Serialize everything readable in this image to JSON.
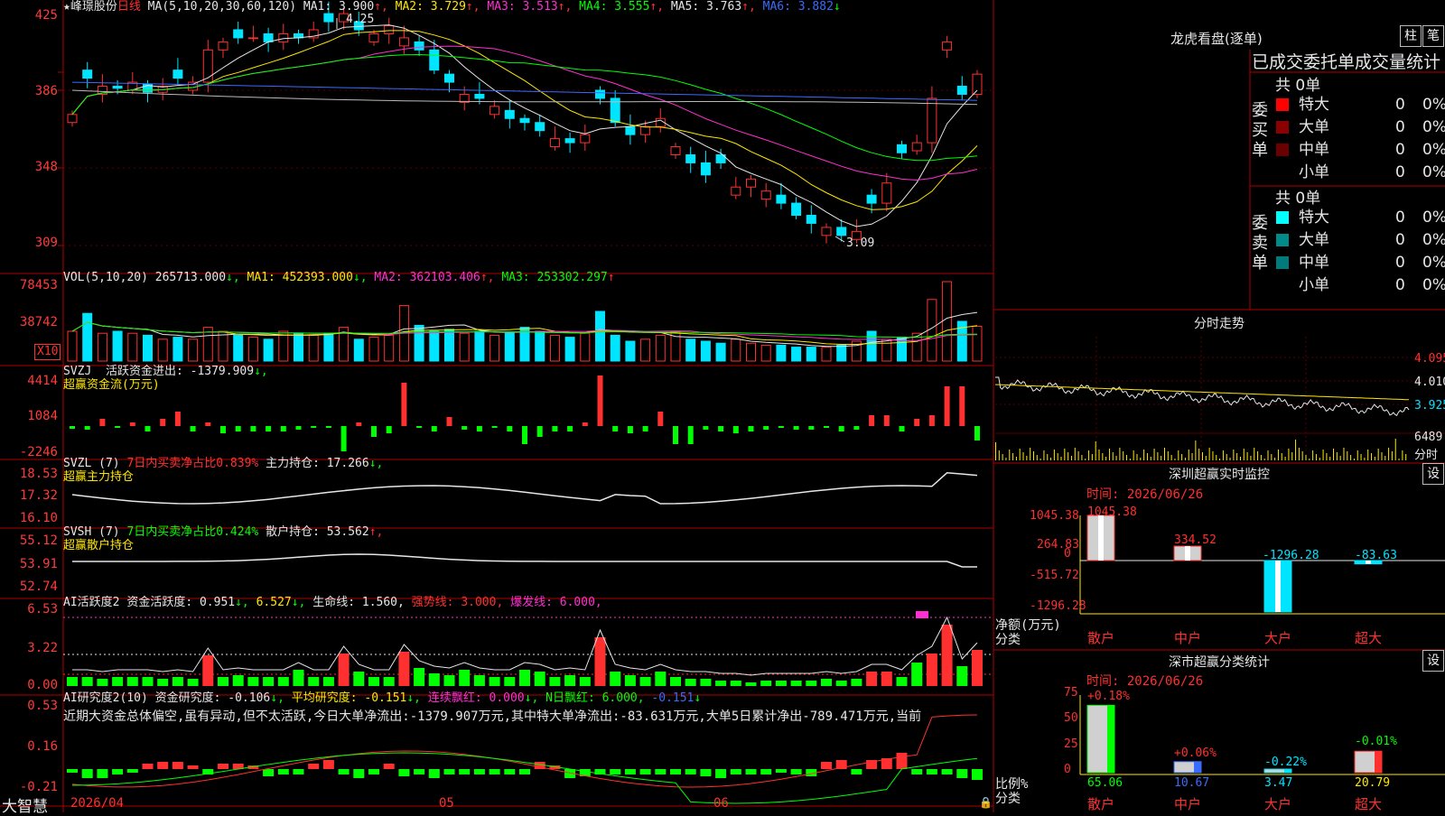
{
  "kline": {
    "stock_name": "★峰璟股份",
    "period": "日线",
    "ma_params": "MA(5,10,20,30,60,120)",
    "indicators": [
      {
        "label": "MA1:",
        "value": "3.900",
        "arrow": "↑",
        "color": "#e6e6e6"
      },
      {
        "label": "MA2:",
        "value": "3.729",
        "arrow": "↑",
        "color": "#ffe600"
      },
      {
        "label": "MA3:",
        "value": "3.513",
        "arrow": "↑",
        "color": "#ff2fd1"
      },
      {
        "label": "MA4:",
        "value": "3.555",
        "arrow": "↑",
        "color": "#00ff00"
      },
      {
        "label": "MA5:",
        "value": "3.763",
        "arrow": "↑",
        "color": "#e6e6e6"
      },
      {
        "label": "MA6:",
        "value": "3.882",
        "arrow": "↓",
        "color": "#3a6bff"
      }
    ],
    "y_ticks": [
      "425",
      "386",
      "348",
      "309"
    ],
    "high_label": "4.25",
    "low_label": "3.09"
  },
  "vol": {
    "title": "VOL(5,10,20)",
    "value": "265713.000",
    "ma1": "452393.000",
    "ma2": "362103.406",
    "ma3": "253302.297",
    "y_ticks": [
      "78453",
      "38742"
    ],
    "unit_badge": "X10"
  },
  "svzj": {
    "title": "SVZJ",
    "label": "活跃资金进出:",
    "value": "-1379.909",
    "subtitle": "超赢资金流(万元)",
    "y_ticks": [
      "4414",
      "1084",
      "-2246"
    ]
  },
  "svzl": {
    "title": "SVZL (7)",
    "net_label": "7日内买卖净占比0.839%",
    "hold_label": "主力持仓:",
    "hold_value": "17.266",
    "subtitle": "超赢主力持仓",
    "y_ticks": [
      "18.53",
      "17.32",
      "16.10"
    ]
  },
  "svsh": {
    "title": "SVSH (7)",
    "net_label": "7日内买卖净占比0.424%",
    "hold_label": "散户持仓:",
    "hold_value": "53.562",
    "subtitle": "超赢散户持仓",
    "y_ticks": [
      "55.12",
      "53.91",
      "52.74"
    ]
  },
  "ai_active": {
    "title": "AI活跃度2",
    "label": "资金活跃度:",
    "value": "0.951",
    "value2": "6.527",
    "life_label": "生命线:",
    "life_value": "1.560",
    "strong_label": "强势线:",
    "strong_value": "3.000",
    "burst_label": "爆发线:",
    "burst_value": "6.000",
    "y_ticks": [
      "6.53",
      "3.22",
      "0.00"
    ]
  },
  "ai_research": {
    "title": "AI研究度2(10)",
    "label": "资金研究度:",
    "value": "-0.106",
    "avg_label": "平均研究度:",
    "avg_value": "-0.151",
    "red_label": "连续飘红:",
    "red_value": "0.000",
    "nred_label": "N日飘红:",
    "nred_value": "6.000",
    "extra_value": "-0.151",
    "comment": "近期大资金总体偏空,虽有异动,但不太活跃,今日大单净流出:-1379.907万元,其中特大单净流出:-83.631万元,大单5日累计净出-789.471万元,当前",
    "y_ticks": [
      "0.53",
      "0.16",
      "-0.21"
    ]
  },
  "bottom": {
    "brand": "大智慧",
    "dates": [
      "2026/04",
      "05",
      "06"
    ]
  },
  "dragon": {
    "title": "龙虎看盘(逐单)",
    "btn_bar": "柱",
    "btn_pen": "笔",
    "header": "已成交委托单成交量统计",
    "buy_side_label": "委买单",
    "sell_side_label": "委卖单",
    "buy_total": "共 0单",
    "sell_total": "共 0单",
    "buy_rows": [
      {
        "name": "特大",
        "count": "0",
        "pct": "0%",
        "color": "#ff0000"
      },
      {
        "name": "大单",
        "count": "0",
        "pct": "0%",
        "color": "#8b0000"
      },
      {
        "name": "中单",
        "count": "0",
        "pct": "0%",
        "color": "#6b0000"
      },
      {
        "name": "小单",
        "count": "0",
        "pct": "0%",
        "color": ""
      }
    ],
    "sell_rows": [
      {
        "name": "特大",
        "count": "0",
        "pct": "0%",
        "color": "#00ffff"
      },
      {
        "name": "大单",
        "count": "0",
        "pct": "0%",
        "color": "#008b8b"
      },
      {
        "name": "中单",
        "count": "0",
        "pct": "0%",
        "color": "#007a7a"
      },
      {
        "name": "小单",
        "count": "0",
        "pct": "0%",
        "color": ""
      }
    ]
  },
  "intraday": {
    "title": "分时走势",
    "y_ticks": [
      "4.095",
      "4.010",
      "3.925",
      "6489"
    ],
    "xlabel": "分时"
  },
  "sz_monitor": {
    "title": "深圳超赢实时监控",
    "settings": "设",
    "time_label": "时间:",
    "time_value": "2026/06/26",
    "y_ticks": [
      "1045.38",
      "264.83",
      "0",
      "-515.72",
      "-1296.28"
    ],
    "ylabel": "净额(万元)",
    "xlabel": "分类",
    "categories": [
      "散户",
      "中户",
      "大户",
      "超大"
    ],
    "values": [
      1045.38,
      334.52,
      -1296.28,
      -83.63
    ],
    "value_labels": [
      "1045.38",
      "334.52",
      "-1296.28",
      "-83.63"
    ]
  },
  "sz_class": {
    "title": "深市超赢分类统计",
    "settings": "设",
    "time_label": "时间:",
    "time_value": "2026/06/26",
    "y_ticks": [
      "75",
      "50",
      "25",
      "0"
    ],
    "ylabel": "比例%",
    "xlabel": "分类",
    "categories": [
      "散户",
      "中户",
      "大户",
      "超大"
    ],
    "values": [
      65.06,
      10.67,
      3.47,
      20.79
    ],
    "changes": [
      "+0.18%",
      "+0.06%",
      "-0.22%",
      "-0.01%"
    ]
  },
  "chart_data": [
    {
      "type": "bar",
      "title": "深圳超赢实时监控",
      "categories": [
        "散户",
        "中户",
        "大户",
        "超大"
      ],
      "values": [
        1045.38,
        334.52,
        -1296.28,
        -83.63
      ],
      "ylabel": "净额(万元)",
      "xlabel": "分类",
      "ylim": [
        -1296.28,
        1045.38
      ]
    },
    {
      "type": "bar",
      "title": "深市超赢分类统计",
      "categories": [
        "散户",
        "中户",
        "大户",
        "超大"
      ],
      "values": [
        65.06,
        10.67,
        3.47,
        20.79
      ],
      "ylabel": "比例%",
      "xlabel": "分类",
      "ylim": [
        0,
        75
      ]
    }
  ],
  "colors": {
    "up": "#ff3030",
    "down": "#00e5ff",
    "grid": "#b00000",
    "bg": "#000000"
  }
}
